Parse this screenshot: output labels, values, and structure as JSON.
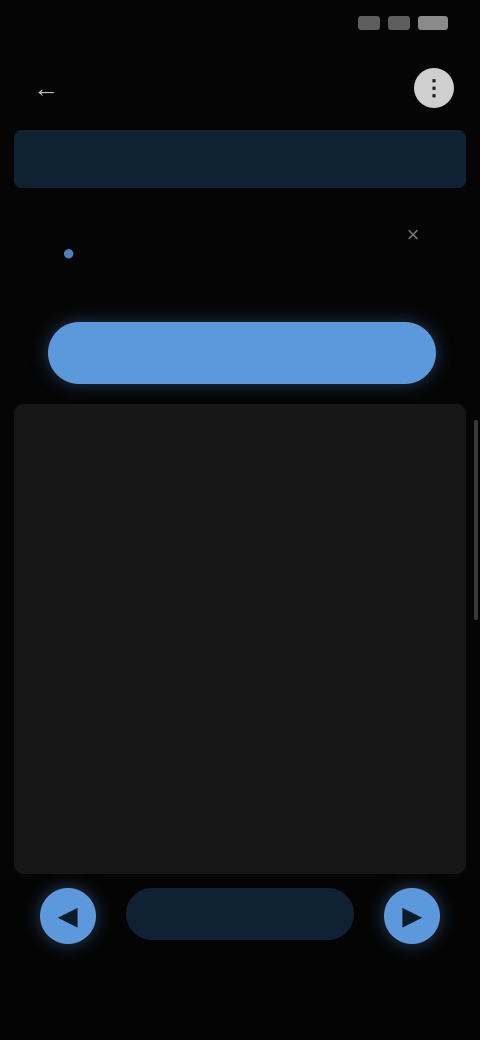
{
  "status_bar": {
    "time": ""
  },
  "app_bar": {
    "title": "",
    "back_icon": "back-arrow-icon",
    "more_icon": "more-icon"
  },
  "banner": {
    "text": ""
  },
  "card": {
    "title": "",
    "subtitle": "",
    "icon": "account-icon",
    "close_icon": "close-icon"
  },
  "primary_button": {
    "label": ""
  },
  "list": {
    "items": [
      "",
      "",
      "",
      "",
      "",
      ""
    ]
  },
  "bottom": {
    "center_label": "",
    "hint": "",
    "left_icon": "left-action-icon",
    "right_icon": "right-action-icon"
  },
  "colors": {
    "accent": "#5b98dc",
    "banner_bg": "#0f2233",
    "panel_bg": "#171717",
    "background": "#050505"
  }
}
